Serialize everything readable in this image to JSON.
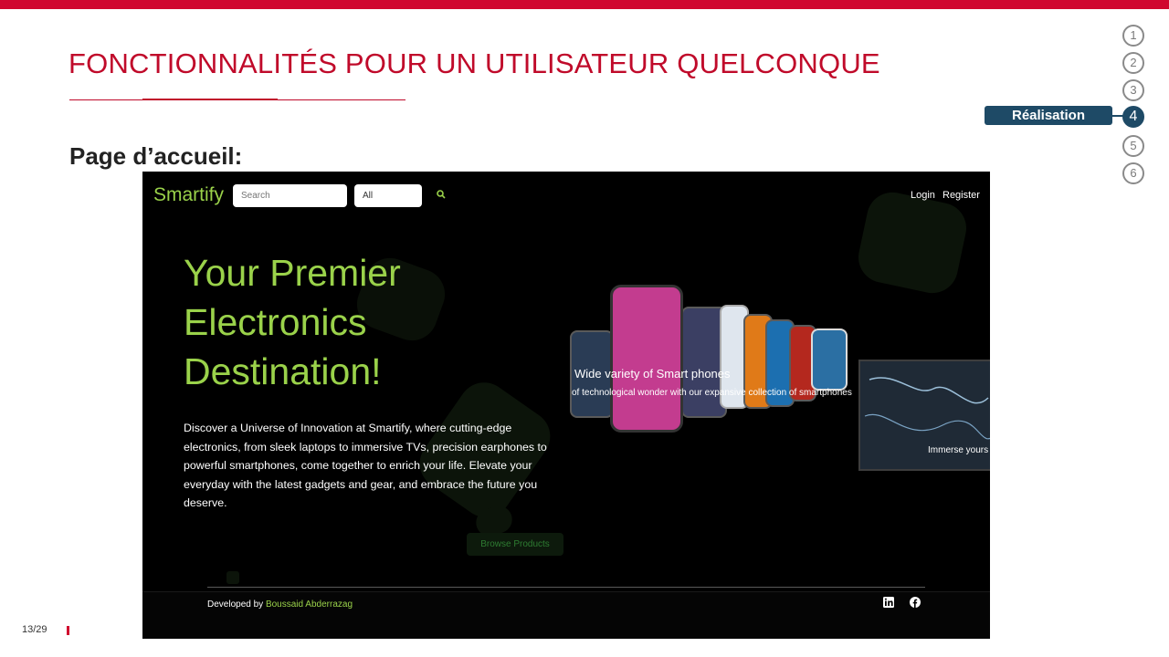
{
  "slide": {
    "title": "FONCTIONNALITÉS POUR UN UTILISATEUR QUELCONQUE",
    "subtitle": "Page d’accueil:",
    "page_number": "13/29"
  },
  "steps": {
    "items": [
      "1",
      "2",
      "3",
      "4",
      "5",
      "6"
    ],
    "active_index": 3,
    "active_label": "Réalisation"
  },
  "website": {
    "logo": "Smartify",
    "search": {
      "placeholder": "Search"
    },
    "category": {
      "value": "All"
    },
    "nav": {
      "login": "Login",
      "register": "Register"
    },
    "hero": {
      "title_line1": "Your Premier",
      "title_line2": "Electronics",
      "title_line3": "Destination!",
      "description": "Discover a Universe of Innovation at Smartify, where cutting-edge electronics, from sleek laptops to immersive TVs, precision earphones to powerful smartphones, come together to enrich your life. Elevate your everyday with the latest gadgets and gear, and embrace the future you deserve.",
      "button": "Browse Products"
    },
    "carousel": {
      "caption": "Wide variety of Smart phones",
      "subcaption": "of technological wonder with our expansive collection of smartphones",
      "tv_caption": "Immerse yours"
    },
    "footer": {
      "developed_by": "Developed by",
      "author": "Boussaid Abderrazag"
    },
    "social_icons": [
      "linkedin-icon",
      "facebook-icon"
    ]
  },
  "colors": {
    "accent_red": "#d0062f",
    "title_red": "#c00a2a",
    "nav_blue": "#1e4a66",
    "brand_green": "#9ad24a"
  }
}
